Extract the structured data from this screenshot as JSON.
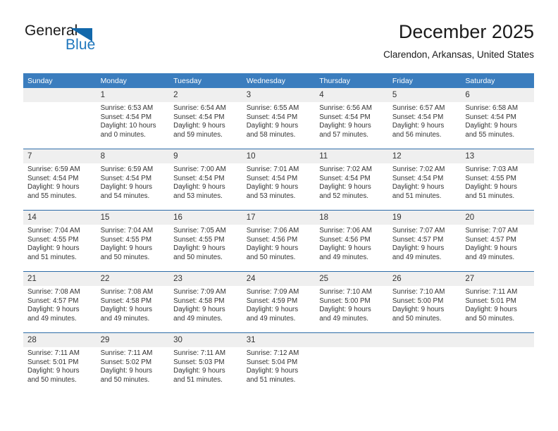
{
  "logo": {
    "part1": "General",
    "part2": "Blue",
    "triangle_color": "#1268ab",
    "blue_text_color": "#1f77bd"
  },
  "header": {
    "month_title": "December 2025",
    "location": "Clarendon, Arkansas, United States"
  },
  "theme": {
    "header_blue": "#3b7dbe",
    "separator_blue": "#2d6ca8",
    "daynum_band": "#efefef",
    "text": "#333333"
  },
  "calendar": {
    "weekday_headers": [
      "Sunday",
      "Monday",
      "Tuesday",
      "Wednesday",
      "Thursday",
      "Friday",
      "Saturday"
    ],
    "weeks": [
      [
        {
          "day": "",
          "sunrise": "",
          "sunset": "",
          "daylight_line1": "",
          "daylight_line2": ""
        },
        {
          "day": "1",
          "sunrise": "Sunrise: 6:53 AM",
          "sunset": "Sunset: 4:54 PM",
          "daylight_line1": "Daylight: 10 hours",
          "daylight_line2": "and 0 minutes."
        },
        {
          "day": "2",
          "sunrise": "Sunrise: 6:54 AM",
          "sunset": "Sunset: 4:54 PM",
          "daylight_line1": "Daylight: 9 hours",
          "daylight_line2": "and 59 minutes."
        },
        {
          "day": "3",
          "sunrise": "Sunrise: 6:55 AM",
          "sunset": "Sunset: 4:54 PM",
          "daylight_line1": "Daylight: 9 hours",
          "daylight_line2": "and 58 minutes."
        },
        {
          "day": "4",
          "sunrise": "Sunrise: 6:56 AM",
          "sunset": "Sunset: 4:54 PM",
          "daylight_line1": "Daylight: 9 hours",
          "daylight_line2": "and 57 minutes."
        },
        {
          "day": "5",
          "sunrise": "Sunrise: 6:57 AM",
          "sunset": "Sunset: 4:54 PM",
          "daylight_line1": "Daylight: 9 hours",
          "daylight_line2": "and 56 minutes."
        },
        {
          "day": "6",
          "sunrise": "Sunrise: 6:58 AM",
          "sunset": "Sunset: 4:54 PM",
          "daylight_line1": "Daylight: 9 hours",
          "daylight_line2": "and 55 minutes."
        }
      ],
      [
        {
          "day": "7",
          "sunrise": "Sunrise: 6:59 AM",
          "sunset": "Sunset: 4:54 PM",
          "daylight_line1": "Daylight: 9 hours",
          "daylight_line2": "and 55 minutes."
        },
        {
          "day": "8",
          "sunrise": "Sunrise: 6:59 AM",
          "sunset": "Sunset: 4:54 PM",
          "daylight_line1": "Daylight: 9 hours",
          "daylight_line2": "and 54 minutes."
        },
        {
          "day": "9",
          "sunrise": "Sunrise: 7:00 AM",
          "sunset": "Sunset: 4:54 PM",
          "daylight_line1": "Daylight: 9 hours",
          "daylight_line2": "and 53 minutes."
        },
        {
          "day": "10",
          "sunrise": "Sunrise: 7:01 AM",
          "sunset": "Sunset: 4:54 PM",
          "daylight_line1": "Daylight: 9 hours",
          "daylight_line2": "and 53 minutes."
        },
        {
          "day": "11",
          "sunrise": "Sunrise: 7:02 AM",
          "sunset": "Sunset: 4:54 PM",
          "daylight_line1": "Daylight: 9 hours",
          "daylight_line2": "and 52 minutes."
        },
        {
          "day": "12",
          "sunrise": "Sunrise: 7:02 AM",
          "sunset": "Sunset: 4:54 PM",
          "daylight_line1": "Daylight: 9 hours",
          "daylight_line2": "and 51 minutes."
        },
        {
          "day": "13",
          "sunrise": "Sunrise: 7:03 AM",
          "sunset": "Sunset: 4:55 PM",
          "daylight_line1": "Daylight: 9 hours",
          "daylight_line2": "and 51 minutes."
        }
      ],
      [
        {
          "day": "14",
          "sunrise": "Sunrise: 7:04 AM",
          "sunset": "Sunset: 4:55 PM",
          "daylight_line1": "Daylight: 9 hours",
          "daylight_line2": "and 51 minutes."
        },
        {
          "day": "15",
          "sunrise": "Sunrise: 7:04 AM",
          "sunset": "Sunset: 4:55 PM",
          "daylight_line1": "Daylight: 9 hours",
          "daylight_line2": "and 50 minutes."
        },
        {
          "day": "16",
          "sunrise": "Sunrise: 7:05 AM",
          "sunset": "Sunset: 4:55 PM",
          "daylight_line1": "Daylight: 9 hours",
          "daylight_line2": "and 50 minutes."
        },
        {
          "day": "17",
          "sunrise": "Sunrise: 7:06 AM",
          "sunset": "Sunset: 4:56 PM",
          "daylight_line1": "Daylight: 9 hours",
          "daylight_line2": "and 50 minutes."
        },
        {
          "day": "18",
          "sunrise": "Sunrise: 7:06 AM",
          "sunset": "Sunset: 4:56 PM",
          "daylight_line1": "Daylight: 9 hours",
          "daylight_line2": "and 49 minutes."
        },
        {
          "day": "19",
          "sunrise": "Sunrise: 7:07 AM",
          "sunset": "Sunset: 4:57 PM",
          "daylight_line1": "Daylight: 9 hours",
          "daylight_line2": "and 49 minutes."
        },
        {
          "day": "20",
          "sunrise": "Sunrise: 7:07 AM",
          "sunset": "Sunset: 4:57 PM",
          "daylight_line1": "Daylight: 9 hours",
          "daylight_line2": "and 49 minutes."
        }
      ],
      [
        {
          "day": "21",
          "sunrise": "Sunrise: 7:08 AM",
          "sunset": "Sunset: 4:57 PM",
          "daylight_line1": "Daylight: 9 hours",
          "daylight_line2": "and 49 minutes."
        },
        {
          "day": "22",
          "sunrise": "Sunrise: 7:08 AM",
          "sunset": "Sunset: 4:58 PM",
          "daylight_line1": "Daylight: 9 hours",
          "daylight_line2": "and 49 minutes."
        },
        {
          "day": "23",
          "sunrise": "Sunrise: 7:09 AM",
          "sunset": "Sunset: 4:58 PM",
          "daylight_line1": "Daylight: 9 hours",
          "daylight_line2": "and 49 minutes."
        },
        {
          "day": "24",
          "sunrise": "Sunrise: 7:09 AM",
          "sunset": "Sunset: 4:59 PM",
          "daylight_line1": "Daylight: 9 hours",
          "daylight_line2": "and 49 minutes."
        },
        {
          "day": "25",
          "sunrise": "Sunrise: 7:10 AM",
          "sunset": "Sunset: 5:00 PM",
          "daylight_line1": "Daylight: 9 hours",
          "daylight_line2": "and 49 minutes."
        },
        {
          "day": "26",
          "sunrise": "Sunrise: 7:10 AM",
          "sunset": "Sunset: 5:00 PM",
          "daylight_line1": "Daylight: 9 hours",
          "daylight_line2": "and 50 minutes."
        },
        {
          "day": "27",
          "sunrise": "Sunrise: 7:11 AM",
          "sunset": "Sunset: 5:01 PM",
          "daylight_line1": "Daylight: 9 hours",
          "daylight_line2": "and 50 minutes."
        }
      ],
      [
        {
          "day": "28",
          "sunrise": "Sunrise: 7:11 AM",
          "sunset": "Sunset: 5:01 PM",
          "daylight_line1": "Daylight: 9 hours",
          "daylight_line2": "and 50 minutes."
        },
        {
          "day": "29",
          "sunrise": "Sunrise: 7:11 AM",
          "sunset": "Sunset: 5:02 PM",
          "daylight_line1": "Daylight: 9 hours",
          "daylight_line2": "and 50 minutes."
        },
        {
          "day": "30",
          "sunrise": "Sunrise: 7:11 AM",
          "sunset": "Sunset: 5:03 PM",
          "daylight_line1": "Daylight: 9 hours",
          "daylight_line2": "and 51 minutes."
        },
        {
          "day": "31",
          "sunrise": "Sunrise: 7:12 AM",
          "sunset": "Sunset: 5:04 PM",
          "daylight_line1": "Daylight: 9 hours",
          "daylight_line2": "and 51 minutes."
        },
        {
          "day": "",
          "sunrise": "",
          "sunset": "",
          "daylight_line1": "",
          "daylight_line2": ""
        },
        {
          "day": "",
          "sunrise": "",
          "sunset": "",
          "daylight_line1": "",
          "daylight_line2": ""
        },
        {
          "day": "",
          "sunrise": "",
          "sunset": "",
          "daylight_line1": "",
          "daylight_line2": ""
        }
      ]
    ]
  }
}
